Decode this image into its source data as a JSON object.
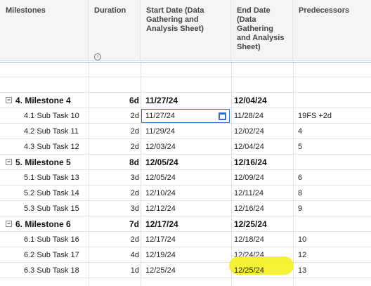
{
  "header": {
    "milestones": "Milestones",
    "duration": "Duration",
    "start_date": "Start Date (Data Gathering and Analysis Sheet)",
    "end_date": "End Date (Data Gathering and Analysis Sheet)",
    "predecessors": "Predecessors"
  },
  "rows": [
    {
      "name": "4. Milestone 4",
      "duration": "6d",
      "start": "11/27/24",
      "end": "12/04/24",
      "pred": ""
    },
    {
      "name": "4.1 Sub Task 10",
      "duration": "2d",
      "start": "11/27/24",
      "end": "11/28/24",
      "pred": "19FS +2d"
    },
    {
      "name": "4.2 Sub Task 11",
      "duration": "2d",
      "start": "11/29/24",
      "end": "12/02/24",
      "pred": "4"
    },
    {
      "name": "4.3 Sub Task 12",
      "duration": "2d",
      "start": "12/03/24",
      "end": "12/04/24",
      "pred": "5"
    },
    {
      "name": "5. Milestone 5",
      "duration": "8d",
      "start": "12/05/24",
      "end": "12/16/24",
      "pred": ""
    },
    {
      "name": "5.1 Sub Task 13",
      "duration": "3d",
      "start": "12/05/24",
      "end": "12/09/24",
      "pred": "6"
    },
    {
      "name": "5.2 Sub Task 14",
      "duration": "2d",
      "start": "12/10/24",
      "end": "12/11/24",
      "pred": "8"
    },
    {
      "name": "5.3 Sub Task 15",
      "duration": "3d",
      "start": "12/12/24",
      "end": "12/16/24",
      "pred": "9"
    },
    {
      "name": "6. Milestone 6",
      "duration": "7d",
      "start": "12/17/24",
      "end": "12/25/24",
      "pred": ""
    },
    {
      "name": "6.1 Sub Task 16",
      "duration": "2d",
      "start": "12/17/24",
      "end": "12/18/24",
      "pred": "10"
    },
    {
      "name": "6.2 Sub Task 17",
      "duration": "4d",
      "start": "12/19/24",
      "end": "12/24/24",
      "pred": "12"
    },
    {
      "name": "6.3 Sub Task 18",
      "duration": "1d",
      "start": "12/25/24",
      "end": "12/25/24",
      "pred": "13"
    }
  ],
  "toggle_symbol": "−",
  "info_symbol": "i",
  "colors": {
    "selection": "#2f6fce",
    "highlight": "#f7f02a"
  }
}
